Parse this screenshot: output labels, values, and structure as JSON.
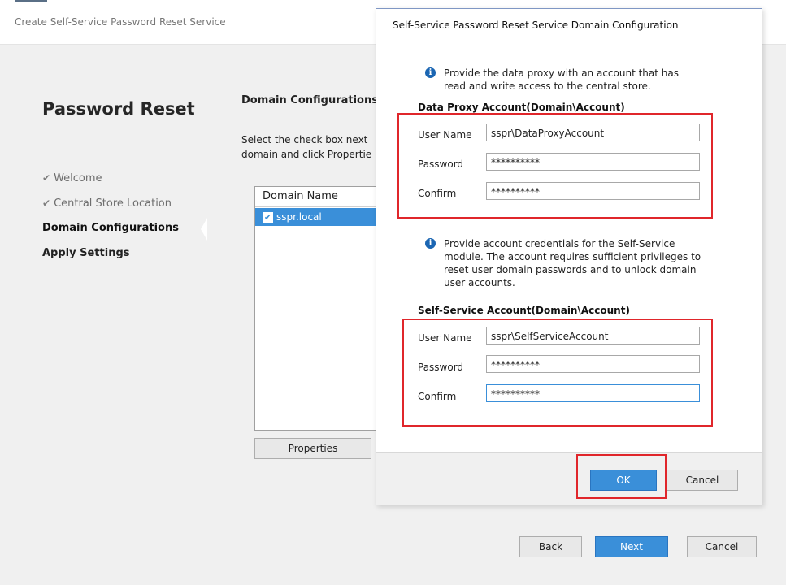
{
  "window": {
    "title": "Create Self-Service Password Reset Service"
  },
  "wizard": {
    "heading": "Password Reset",
    "steps": [
      {
        "label": "Welcome",
        "state": "done"
      },
      {
        "label": "Central Store Location",
        "state": "done"
      },
      {
        "label": "Domain Configurations",
        "state": "active"
      },
      {
        "label": "Apply Settings",
        "state": "pending"
      }
    ]
  },
  "content": {
    "section_title": "Domain Configurations",
    "description_line1": "Select the check box next",
    "description_line2": "domain and click Propertie",
    "list_header": "Domain Name",
    "domains": [
      {
        "name": "sspr.local",
        "checked": true
      }
    ],
    "properties_label": "Properties"
  },
  "footer": {
    "back_label": "Back",
    "next_label": "Next",
    "cancel_label": "Cancel"
  },
  "dialog": {
    "title": "Self-Service Password Reset Service Domain Configuration",
    "proxy_info_line1": "Provide the data proxy with an account that has",
    "proxy_info_line2": "read and write access to the central store.",
    "proxy_group_title": "Data Proxy Account(Domain\\Account)",
    "proxy_user_label": "User Name",
    "proxy_user_value": "sspr\\DataProxyAccount",
    "proxy_password_label": "Password",
    "proxy_password_value": "**********",
    "proxy_confirm_label": "Confirm",
    "proxy_confirm_value": "**********",
    "ss_info_line1": "Provide account credentials for the Self-Service",
    "ss_info_line2": "module. The account requires sufficient privileges to",
    "ss_info_line3": "reset user domain passwords and to unlock domain",
    "ss_info_line4": "user accounts.",
    "ss_group_title": "Self-Service Account(Domain\\Account)",
    "ss_user_label": "User Name",
    "ss_user_value": "sspr\\SelfServiceAccount",
    "ss_password_label": "Password",
    "ss_password_value": "**********",
    "ss_confirm_label": "Confirm",
    "ss_confirm_value": "**********",
    "ok_label": "OK",
    "cancel_label": "Cancel"
  },
  "colors": {
    "accent": "#3a8fd9",
    "highlight_red": "#e0262b",
    "info_icon": "#1b66b3"
  },
  "icons": {
    "check": "checkmark-icon",
    "info": "info-icon",
    "checkbox": "checkbox-checked-icon"
  }
}
